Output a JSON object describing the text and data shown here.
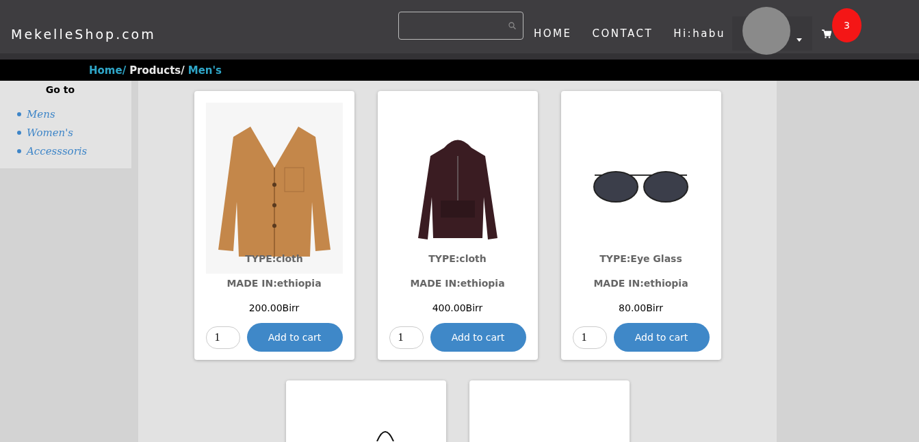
{
  "header": {
    "logo": "MekelleShop.com",
    "nav": [
      "HOME",
      "CONTACT",
      "Hi:habu"
    ],
    "cart_count": "3"
  },
  "breadcrumb": [
    {
      "label": "Home/",
      "link": true
    },
    {
      "label": "Products/",
      "link": false
    },
    {
      "label": "Men's",
      "link": true
    }
  ],
  "sidebar": {
    "title": "Go to",
    "items": [
      "Mens",
      "Women's",
      "Accesssoris"
    ]
  },
  "products": [
    {
      "kind": "full",
      "type": "TYPE:cloth",
      "made_in": "MADE IN:ethiopia",
      "price": "200.00Birr",
      "quantity": "1",
      "button": "Add to cart"
    },
    {
      "kind": "full",
      "type": "TYPE:cloth",
      "made_in": "MADE IN:ethiopia",
      "price": "400.00Birr",
      "quantity": "1",
      "button": "Add to cart"
    },
    {
      "kind": "full",
      "type": "TYPE:Eye Glass",
      "made_in": "MADE IN:ethiopia",
      "price": "80.00Birr",
      "quantity": "1",
      "button": "Add to cart"
    },
    {
      "kind": "image"
    },
    {
      "kind": "image"
    }
  ]
}
